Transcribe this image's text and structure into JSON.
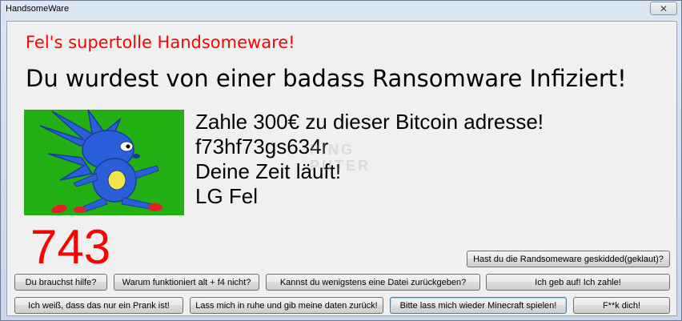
{
  "window": {
    "title": "HandsomeWare",
    "close_glyph": "✕"
  },
  "content": {
    "subtitle": "Fel's supertolle Handsomeware!",
    "headline": "Du wurdest von einer badass Ransomware Infiziert!",
    "message_lines": [
      "Zahle 300€ zu dieser Bitcoin adresse!",
      "f73hf73gs634r",
      "Deine Zeit läuft!",
      "LG Fel"
    ],
    "counter": "743",
    "watermark": [
      "PING",
      "PUTER"
    ]
  },
  "buttons": {
    "skidded": "Hast du die Randsomeware geskidded(geklaut)?",
    "help": "Du brauchst hilfe?",
    "altf4": "Warum funktioniert alt + f4 nicht?",
    "restore_file": "Kannst du wenigstens eine Datei zurückgeben?",
    "give_up": "Ich geb auf! Ich zahle!",
    "prank": "Ich weiß, dass das nur ein Prank ist!",
    "leave_alone": "Lass mich in ruhe und gib meine daten zurück!",
    "minecraft": "Bitte lass mich wieder Minecraft spielen!",
    "insult": "F**k dich!"
  },
  "colors": {
    "accent_red": "#ff0000",
    "picture_green": "#22b014",
    "character_blue": "#2b5fd9"
  },
  "icons": {
    "picture": "blue-hedgehog-character",
    "close": "close-icon"
  }
}
